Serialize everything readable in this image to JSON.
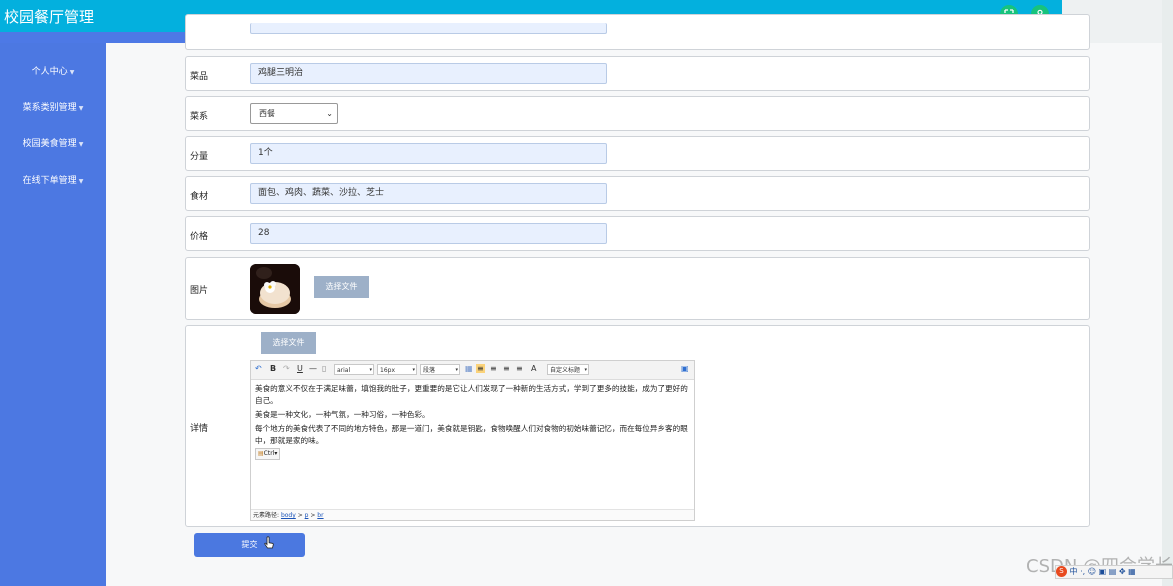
{
  "app": {
    "title": "校园餐厅管理"
  },
  "header": {
    "fullscreen_icon": "fullscreen-icon",
    "user_icon": "user-icon"
  },
  "sidebar": {
    "items": [
      {
        "label": "个人中心"
      },
      {
        "label": "菜系类别管理"
      },
      {
        "label": "校园美食管理"
      },
      {
        "label": "在线下单管理"
      }
    ]
  },
  "form": {
    "dish": {
      "label": "菜品",
      "value": "鸡腿三明治"
    },
    "cuisine": {
      "label": "菜系",
      "value": "西餐"
    },
    "portion": {
      "label": "分量",
      "value": "1个"
    },
    "ingredients": {
      "label": "食材",
      "value": "面包、鸡肉、蔬菜、沙拉、芝士"
    },
    "price": {
      "label": "价格",
      "value": "28"
    },
    "image": {
      "label": "图片",
      "button": "选择文件"
    },
    "detail": {
      "label": "详情",
      "button": "选择文件",
      "toolbar": {
        "font": "arial",
        "size": "16px",
        "format": "段落",
        "custom": "自定义标题",
        "bold": "B",
        "underline": "U",
        "font_color": "A"
      },
      "paragraphs": [
        "美食的意义不仅在于满足味蕾，填饱我的肚子，更重要的是它让人们发现了一种新的生活方式，学到了更多的技能，成为了更好的自己。",
        "美食是一种文化，一种气氛，一种习俗，一种色彩。",
        "每个地方的美食代表了不同的地方特色，那是一道门，美食就是钥匙，食物唤醒人们对食物的初始味蕾记忆，而在每位异乡客的眼中，那就是家的味。"
      ],
      "paste_chip": "Ctrl",
      "status_prefix": "元素路径:",
      "path": [
        "body",
        "p",
        "br"
      ]
    },
    "submit": "提交"
  },
  "overlay": {
    "watermark": "CSDN @四会学长",
    "ime": "中 ·,"
  }
}
